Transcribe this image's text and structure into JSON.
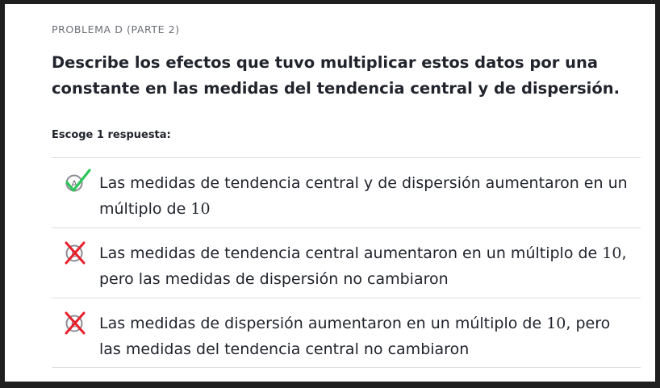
{
  "problem": {
    "label": "PROBLEMA D (PARTE 2)",
    "question": "Describe los efectos que tuvo multiplicar estos datos por una constante en las medidas del tendencia central y de dispersión.",
    "instruction": "Escoge 1 respuesta:"
  },
  "choices": [
    {
      "letter": "A",
      "text_before": "Las medidas de tendencia central y de dispersión aumentaron en un múltiplo de ",
      "number": "10",
      "text_after": "",
      "status": "correct",
      "status_icon": "check-icon",
      "status_color": "#1fab54"
    },
    {
      "letter": "B",
      "text_before": "Las medidas de tendencia central aumentaron en un múltiplo de ",
      "number": "10",
      "text_after": ", pero las medidas de dispersión no cambiaron",
      "status": "incorrect",
      "status_icon": "x-icon",
      "status_color": "#e8202c"
    },
    {
      "letter": "C",
      "text_before": "Las medidas de dispersión aumentaron en un múltiplo de ",
      "number": "10",
      "text_after": ", pero las medidas del tendencia central no cambiaron",
      "status": "incorrect",
      "status_icon": "x-icon",
      "status_color": "#e8202c"
    }
  ]
}
